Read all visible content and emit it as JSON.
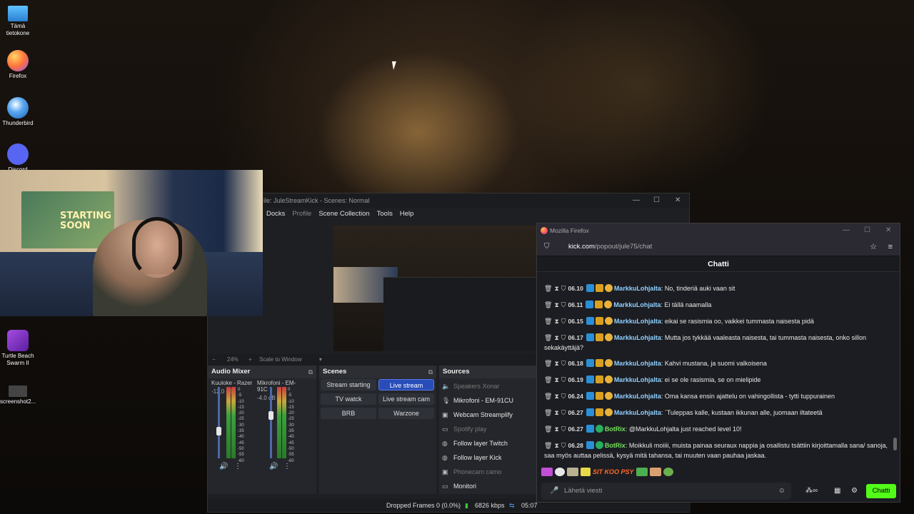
{
  "desktop": {
    "icons": [
      {
        "label": "Tämä tietokone",
        "icon": "computer-icon",
        "color": "#3aa0e8"
      },
      {
        "label": "Firefox",
        "icon": "firefox-icon",
        "color": "#ff7139"
      },
      {
        "label": "Thunderbird",
        "icon": "thunderbird-icon",
        "color": "#2b7fd8"
      },
      {
        "label": "Discord",
        "icon": "discord-icon",
        "color": "#5865f2"
      },
      {
        "label": "Turtle Beach Swarm II",
        "icon": "turtle-beach-icon",
        "color": "#7a2cc6"
      },
      {
        "label": "screenshot2...",
        "icon": "image-file-icon",
        "color": "#555555"
      }
    ]
  },
  "webcam": {
    "poster_text": "STARTING SOON"
  },
  "obs": {
    "title": "ile: JuleStreamKick - Scenes: Normal",
    "menu": [
      "Docks",
      "Profile",
      "Scene Collection",
      "Tools",
      "Help"
    ],
    "zoom_minus": "−",
    "zoom_level": "24%",
    "zoom_plus": "+",
    "zoom_mode": "Scale to Window",
    "audio_mixer": {
      "title": "Audio Mixer",
      "channels": [
        {
          "name": "Kuuloke - Razer",
          "db": "-12.0 dB"
        },
        {
          "name": "Mikrofoni - EM-91C",
          "db": "-4.0 dB"
        }
      ],
      "scale": [
        "0",
        "-5",
        "-10",
        "-15",
        "-20",
        "-25",
        "-30",
        "-35",
        "-40",
        "-45",
        "-50",
        "-55",
        "-60"
      ]
    },
    "scenes": {
      "title": "Scenes",
      "items": [
        "Stream starting",
        "Live stream",
        "TV watck",
        "Live stream cam",
        "BRB",
        "Warzone"
      ],
      "active": "Live stream"
    },
    "sources": {
      "title": "Sources",
      "items": [
        {
          "label": "Speakers Xonar",
          "icon": "speaker-icon",
          "dim": true
        },
        {
          "label": "Mikrofoni - EM-91CU",
          "icon": "microphone-icon",
          "dim": false
        },
        {
          "label": "Webcam Streamplify",
          "icon": "camera-icon",
          "dim": false
        },
        {
          "label": "Spotify play",
          "icon": "window-icon",
          "dim": true
        },
        {
          "label": "Follow layer Twitch",
          "icon": "globe-icon",
          "dim": false
        },
        {
          "label": "Follow layer Kick",
          "icon": "globe-icon",
          "dim": false
        },
        {
          "label": "Phonecam camo",
          "icon": "camera-icon",
          "dim": true
        },
        {
          "label": "Monitori",
          "icon": "monitor-icon",
          "dim": false
        }
      ]
    },
    "status": {
      "dropped_frames": "Dropped Frames 0 (0.0%)",
      "bitrate": "6826 kbps",
      "time": "05:07"
    }
  },
  "firefox": {
    "title": "Mozilla Firefox",
    "url_domain": "kick.com",
    "url_path": "/popout/jule75/chat",
    "chat_title": "Chatti",
    "messages": [
      {
        "time": "06.10",
        "user": "MarkkuLohjalta",
        "text": "No, tinderiä auki vaan sit",
        "bot": false
      },
      {
        "time": "06.11",
        "user": "MarkkuLohjalta",
        "text": "Ei tällä naamalla",
        "bot": false
      },
      {
        "time": "06.15",
        "user": "MarkkuLohjalta",
        "text": "eikai se rasismia oo, vaikkei tummasta naisesta pidä",
        "bot": false
      },
      {
        "time": "06.17",
        "user": "MarkkuLohjalta",
        "text": "Mutta jos tykkää vaaleasta naisesta, tai tummasta naisesta, onko sillon sekakäyttäjä?",
        "bot": false
      },
      {
        "time": "06.18",
        "user": "MarkkuLohjalta",
        "text": "Kahvi mustana, ja suomi valkoisena",
        "bot": false
      },
      {
        "time": "06.19",
        "user": "MarkkuLohjalta",
        "text": "ei se ole rasismia, se on mielipide",
        "bot": false
      },
      {
        "time": "06.24",
        "user": "MarkkuLohjalta",
        "text": "Oma kansa ensin ajattelu on vahingollista - tytti tuppurainen",
        "bot": false
      },
      {
        "time": "06.27",
        "user": "MarkkuLohjalta",
        "text": "`Tuleppas kalle, kustaan ikkunan alle, juomaan iltateetä",
        "bot": false
      },
      {
        "time": "06.27",
        "user": "BotRix",
        "text": "@MarkkuLohjalta just reached level 10!",
        "bot": true
      },
      {
        "time": "06.28",
        "user": "BotRix",
        "text": "Moikkuli moiiii, muista painaa seuraux nappia ja osallistu tsättiin kirjoittamalla sana/ sanoja, saa myös auttaa pelissä, kysyä mitä tahansa, tai muuten vaan pauhaa jaskaa.",
        "bot": true
      }
    ],
    "emote_text": "SIT KOO PSY",
    "input_placeholder": "Lähetä viesti",
    "send_label": "Chatti",
    "accent_color": "#53fc18"
  }
}
